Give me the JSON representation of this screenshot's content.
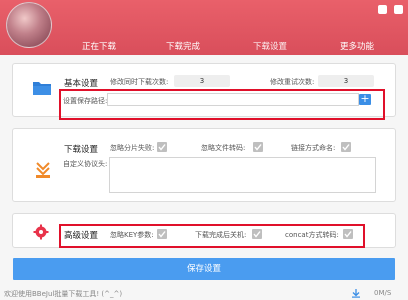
{
  "nav": {
    "items": [
      {
        "label": "正在下载"
      },
      {
        "label": "下载完成"
      },
      {
        "label": "下载设置"
      },
      {
        "label": "更多功能"
      }
    ]
  },
  "basic": {
    "title": "基本设置",
    "concurrent_label": "修改同时下载次数:",
    "concurrent_value": "3",
    "retry_label": "修改重试次数:",
    "retry_value": "3",
    "path_label": "设置保存路径:",
    "path_value": "",
    "plus_label": "+"
  },
  "download": {
    "title": "下载设置",
    "ignore_segment_fail_label": "忽略分片失败:",
    "ignore_segment_fail_checked": true,
    "ignore_file_transcode_label": "忽略文件转码:",
    "ignore_file_transcode_checked": true,
    "link_naming_label": "链接方式命名:",
    "link_naming_checked": true,
    "custom_header_label": "自定义协议头:",
    "custom_header_value": ""
  },
  "advanced": {
    "title": "高级设置",
    "ignore_key_label": "忽略KEY参数:",
    "ignore_key_checked": true,
    "shutdown_label": "下载完成后关机:",
    "shutdown_checked": true,
    "concat_label": "concat方式转码:",
    "concat_checked": true
  },
  "save_button": {
    "label": "保存设置"
  },
  "status": {
    "message": "欢迎使用BBeJul批量下载工具!  (^_^)",
    "speed": "0M/S"
  },
  "colors": {
    "header": "#e25a66",
    "primary_button": "#4a9cf0",
    "highlight": "#e0102a",
    "folder_icon": "#2f7fd8",
    "download_icon": "#f08a2a",
    "gear_icon": "#e8334a"
  }
}
